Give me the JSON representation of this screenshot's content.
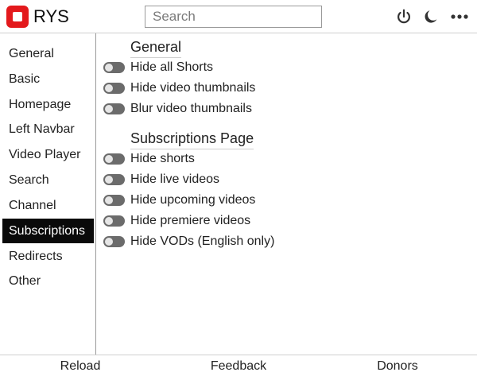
{
  "header": {
    "app_title": "RYS",
    "search_placeholder": "Search",
    "icons": [
      "power-icon",
      "moon-icon",
      "more-icon"
    ]
  },
  "sidebar": {
    "items": [
      {
        "label": "General"
      },
      {
        "label": "Basic"
      },
      {
        "label": "Homepage"
      },
      {
        "label": "Left Navbar"
      },
      {
        "label": "Video Player"
      },
      {
        "label": "Search"
      },
      {
        "label": "Channel"
      },
      {
        "label": "Subscriptions",
        "active": true
      },
      {
        "label": "Redirects"
      },
      {
        "label": "Other"
      }
    ]
  },
  "main": {
    "sections": [
      {
        "title": "General",
        "options": [
          {
            "label": "Hide all Shorts",
            "enabled": false
          },
          {
            "label": "Hide video thumbnails",
            "enabled": false
          },
          {
            "label": "Blur video thumbnails",
            "enabled": false
          }
        ]
      },
      {
        "title": "Subscriptions Page",
        "options": [
          {
            "label": "Hide shorts",
            "enabled": false
          },
          {
            "label": "Hide live videos",
            "enabled": false
          },
          {
            "label": "Hide upcoming videos",
            "enabled": false
          },
          {
            "label": "Hide premiere videos",
            "enabled": false
          },
          {
            "label": "Hide VODs (English only)",
            "enabled": false
          }
        ]
      }
    ]
  },
  "footer": {
    "reload_label": "Reload",
    "feedback_label": "Feedback",
    "donors_label": "Donors"
  },
  "colors": {
    "brand": "#e3191c",
    "active_nav": "#0a0a0a",
    "toggle_off": "#6b6b6b"
  }
}
